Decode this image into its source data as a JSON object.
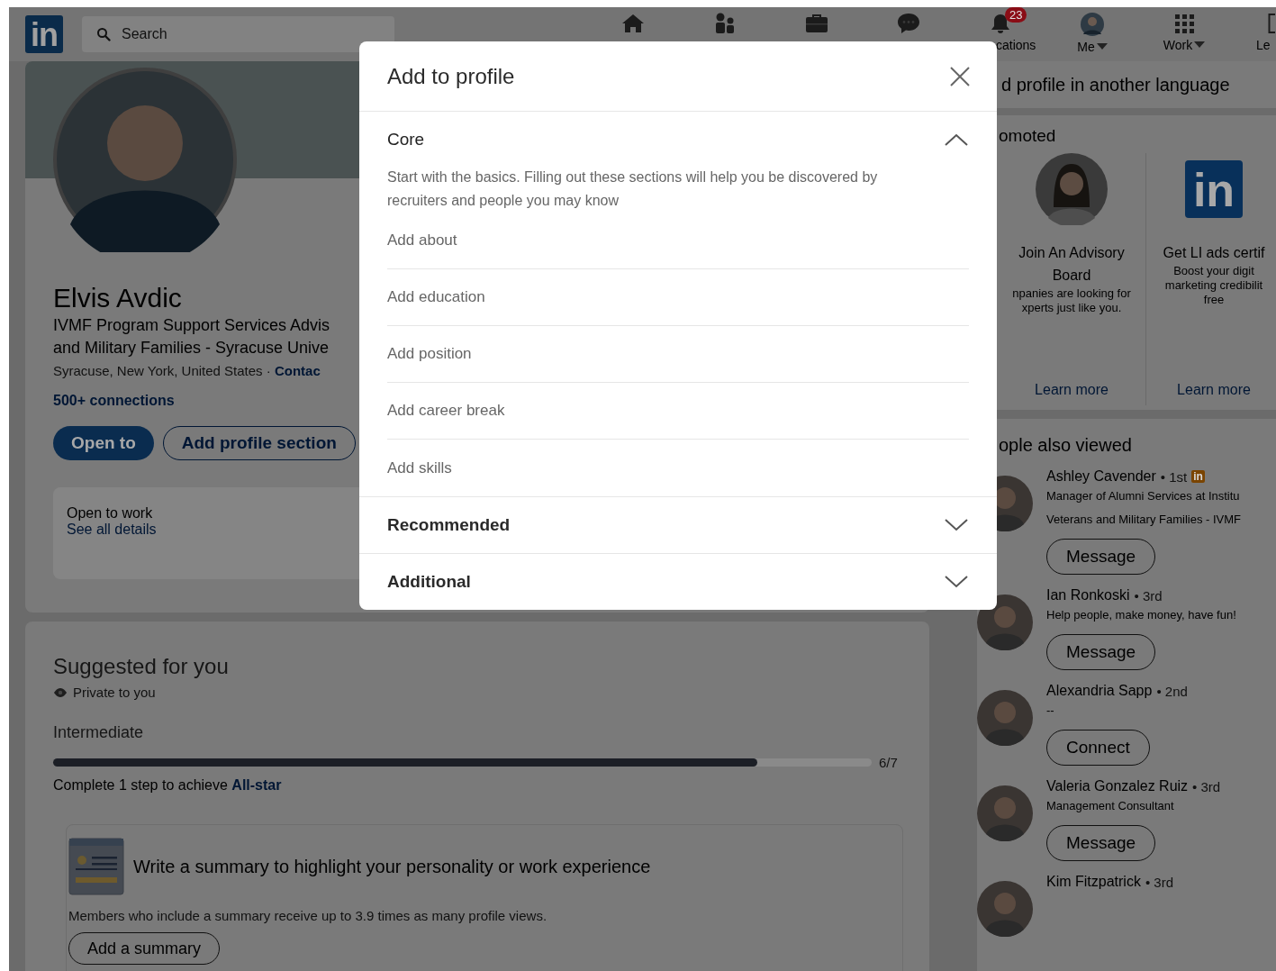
{
  "nav": {
    "logo": "in",
    "search": {
      "placeholder": "Search"
    },
    "items": [
      {
        "kind": "home"
      },
      {
        "kind": "network"
      },
      {
        "kind": "jobs"
      },
      {
        "kind": "messaging"
      },
      {
        "kind": "notifications",
        "label": "cations",
        "badge": "23"
      },
      {
        "kind": "me",
        "label": "Me",
        "dropdown": true
      },
      {
        "kind": "work",
        "label": "Work",
        "dropdown": true
      },
      {
        "kind": "learning",
        "label": "Le"
      }
    ]
  },
  "profile": {
    "name": "Elvis Avdic",
    "headline": [
      "IVMF Program Support Services Advis",
      "and Military Families - Syracuse Unive"
    ],
    "location": "Syracuse, New York, United States ·",
    "contact_link": "Contac",
    "connections": "500+ connections",
    "buttons": [
      {
        "label": "Open to",
        "kind": "primary"
      },
      {
        "label": "Add profile section",
        "kind": "secondary"
      }
    ],
    "open_to_work": {
      "title": "Open to work",
      "link": "See all details"
    }
  },
  "suggested": {
    "title": "Suggested for you",
    "privacy": "Private to you",
    "level_name": "Intermediate",
    "level": 0.86,
    "reading": "6/7",
    "hint": "Complete 1 step to achieve",
    "hint_link": "All-star",
    "card": {
      "title": "Write a summary to highlight your personality or work experience",
      "text": "Members who include a summary receive up to 3.9 times as many profile views.",
      "button": "Add a summary"
    }
  },
  "language_card": {
    "text": "d profile in another language"
  },
  "promoted": {
    "title": "omoted",
    "ads": [
      {
        "kind": "person",
        "title": [
          "Join An Advisory",
          "Board"
        ],
        "text": [
          "npanies are looking for",
          "xperts just like you."
        ],
        "link": "Learn more"
      },
      {
        "kind": "logo",
        "logo": "in",
        "title": [
          "Get LI ads certif"
        ],
        "text": [
          "Boost your digit",
          "marketing credibilit",
          "free"
        ],
        "link": "Learn more"
      }
    ]
  },
  "people": {
    "title": "ople also viewed",
    "items": [
      {
        "name": "Ashley Cavender",
        "degree": "• 1st",
        "premium_badge": "in",
        "headline": [
          "Manager of Alumni Services at Institu",
          "Veterans and Military Families - IVMF"
        ],
        "button": "Message"
      },
      {
        "name": "Ian Ronkoski",
        "degree": "• 3rd",
        "headline": [
          "Help people, make money, have fun!"
        ],
        "button": "Message"
      },
      {
        "name": "Alexandria Sapp",
        "degree": "• 2nd",
        "headline": [
          "--"
        ],
        "button": "Connect"
      },
      {
        "name": "Valeria Gonzalez Ruiz",
        "degree": "• 3rd",
        "headline": [
          "Management Consultant"
        ],
        "button": "Message"
      },
      {
        "name": "Kim Fitzpatrick",
        "degree": "• 3rd"
      }
    ]
  },
  "modal": {
    "title": "Add to profile",
    "sections": [
      {
        "title": "Core",
        "expanded": true,
        "description": "Start with the basics. Filling out these sections will help you be discovered by recruiters and people you may know",
        "items": [
          "Add about",
          "Add education",
          "Add position",
          "Add career break",
          "Add skills"
        ]
      },
      {
        "title": "Recommended",
        "expanded": false
      },
      {
        "title": "Additional",
        "expanded": false
      }
    ]
  }
}
